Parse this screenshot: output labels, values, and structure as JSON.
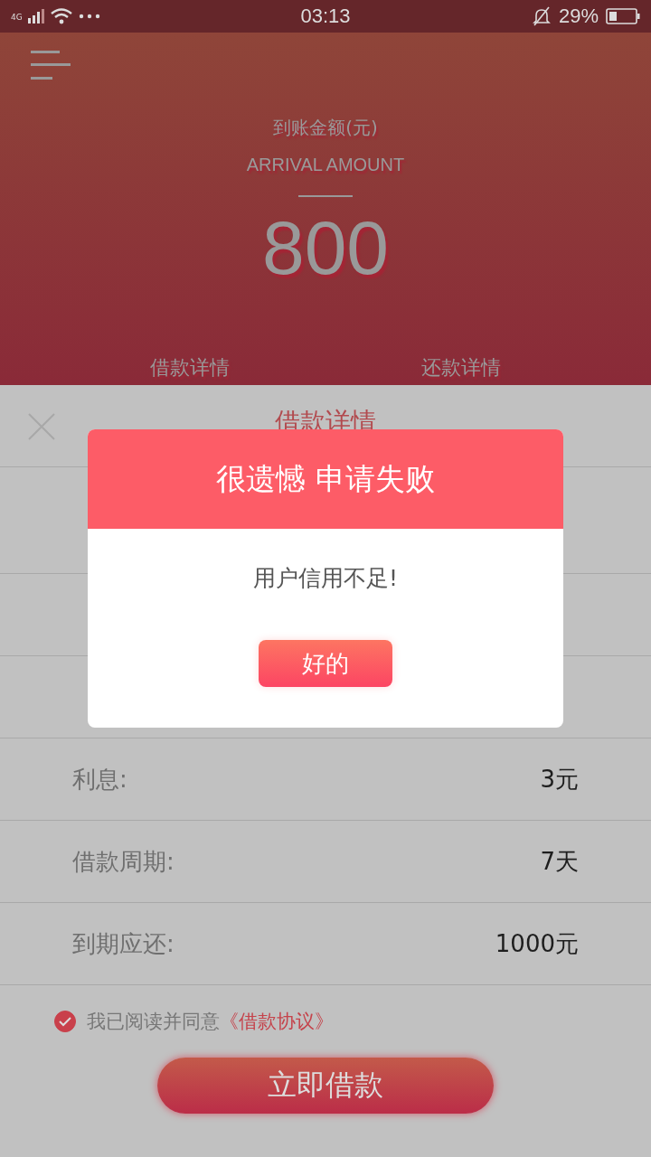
{
  "status_bar": {
    "network": "4G",
    "time": "03:13",
    "battery": "29%"
  },
  "header": {
    "label_cn": "到账金额(元)",
    "label_en": "ARRIVAL AMOUNT",
    "amount": "800",
    "tabs": [
      {
        "label": "借款详情",
        "selected": false
      },
      {
        "label": "还款详情",
        "selected": false
      }
    ]
  },
  "sheet": {
    "title": "借款详情",
    "rows": [
      {
        "label": "利息:",
        "value": "3元"
      },
      {
        "label": "借款周期:",
        "value": "7天"
      },
      {
        "label": "到期应还:",
        "value": "1000元"
      }
    ],
    "agreement": {
      "checked": true,
      "text": "我已阅读并同意",
      "link": "《借款协议》"
    },
    "submit": "立即借款"
  },
  "dialog": {
    "title": "很遗憾 申请失败",
    "message": "用户信用不足!",
    "button": "好的"
  }
}
